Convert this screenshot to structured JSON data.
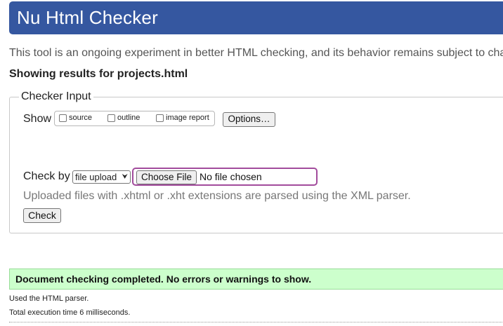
{
  "header": {
    "title": "Nu Html Checker"
  },
  "intro": "This tool is an ongoing experiment in better HTML checking, and its behavior remains subject to cha",
  "showing": "Showing results for projects.html",
  "checker": {
    "legend": "Checker Input",
    "show_label": "Show",
    "show_options": [
      {
        "label": "source",
        "checked": false
      },
      {
        "label": "outline",
        "checked": false
      },
      {
        "label": "image report",
        "checked": false
      }
    ],
    "options_button": "Options…",
    "check_by_label": "Check by",
    "check_by_value": "file upload",
    "choose_file_button": "Choose File",
    "no_file_text": "No file chosen",
    "hint": "Uploaded files with .xhtml or .xht extensions are parsed using the XML parser.",
    "check_button": "Check"
  },
  "result": {
    "success_message": "Document checking completed. No errors or warnings to show.",
    "parser_note": "Used the HTML parser.",
    "execution_time": "Total execution time 6 milliseconds."
  },
  "colors": {
    "header_bg": "#3557a0",
    "success_bg": "#ccffcc",
    "file_focus_border": "#a24b9c"
  }
}
